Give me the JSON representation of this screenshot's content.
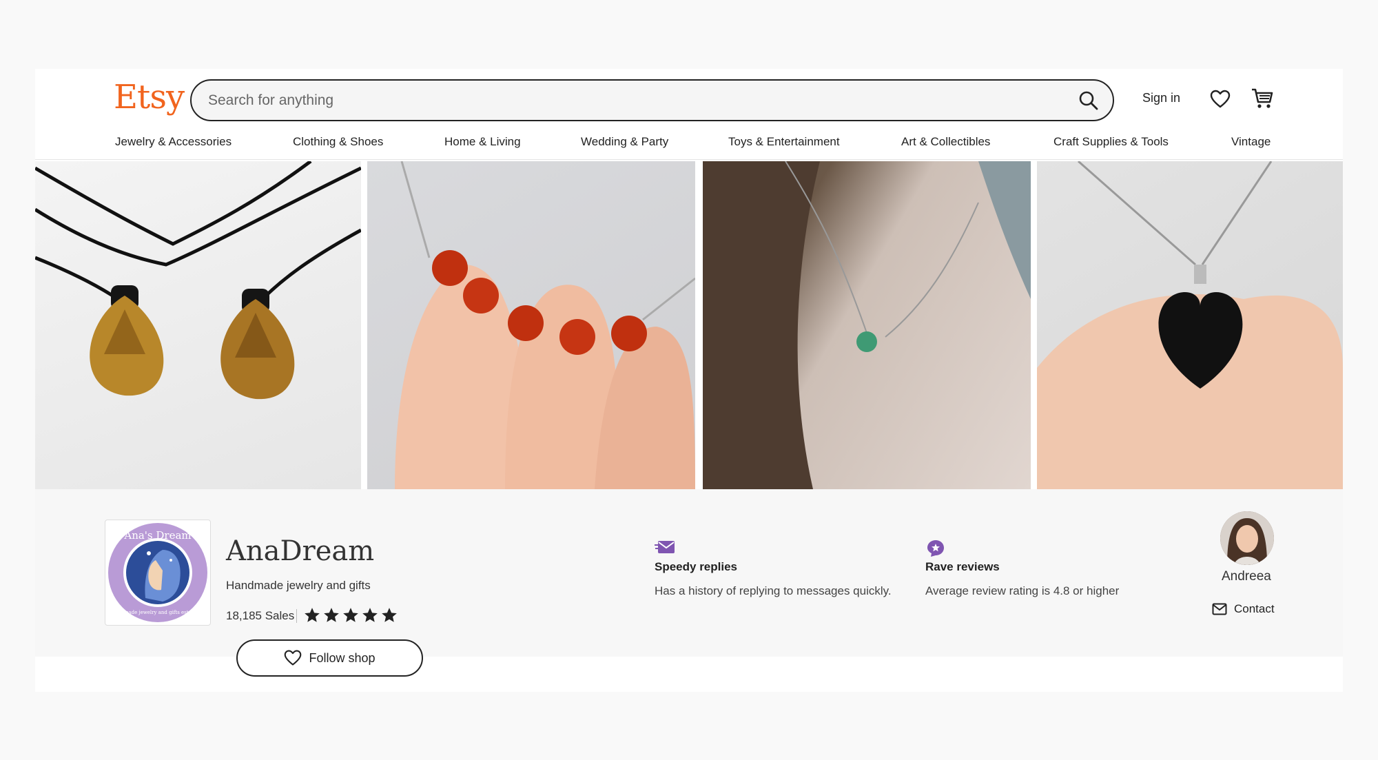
{
  "header": {
    "logo": "Etsy",
    "search_placeholder": "Search for anything",
    "signin_label": "Sign in",
    "icons": [
      "search-icon",
      "heart-icon",
      "cart-icon"
    ]
  },
  "categories": [
    "Jewelry & Accessories",
    "Clothing & Shoes",
    "Home & Living",
    "Wedding & Party",
    "Toys & Entertainment",
    "Art & Collectibles",
    "Craft Supplies & Tools",
    "Vintage"
  ],
  "shop": {
    "name": "AnaDream",
    "tagline": "Handmade jewelry and gifts",
    "sales": "18,185 Sales",
    "rating_stars": 5,
    "follow_label": "Follow shop",
    "logo_text": "Ana's Dream",
    "logo_subtext": "handmade jewelry and gifts est. 2017"
  },
  "badges": [
    {
      "title": "Speedy replies",
      "desc": "Has a history of replying to messages quickly.",
      "icon": "envelope-icon"
    },
    {
      "title": "Rave reviews",
      "desc": "Average review rating is 4.8 or higher",
      "icon": "star-badge-icon"
    }
  ],
  "owner": {
    "name": "Andreea",
    "contact_label": "Contact"
  },
  "colors": {
    "brand": "#f1641e",
    "badge_purple": "#7f55b1"
  }
}
